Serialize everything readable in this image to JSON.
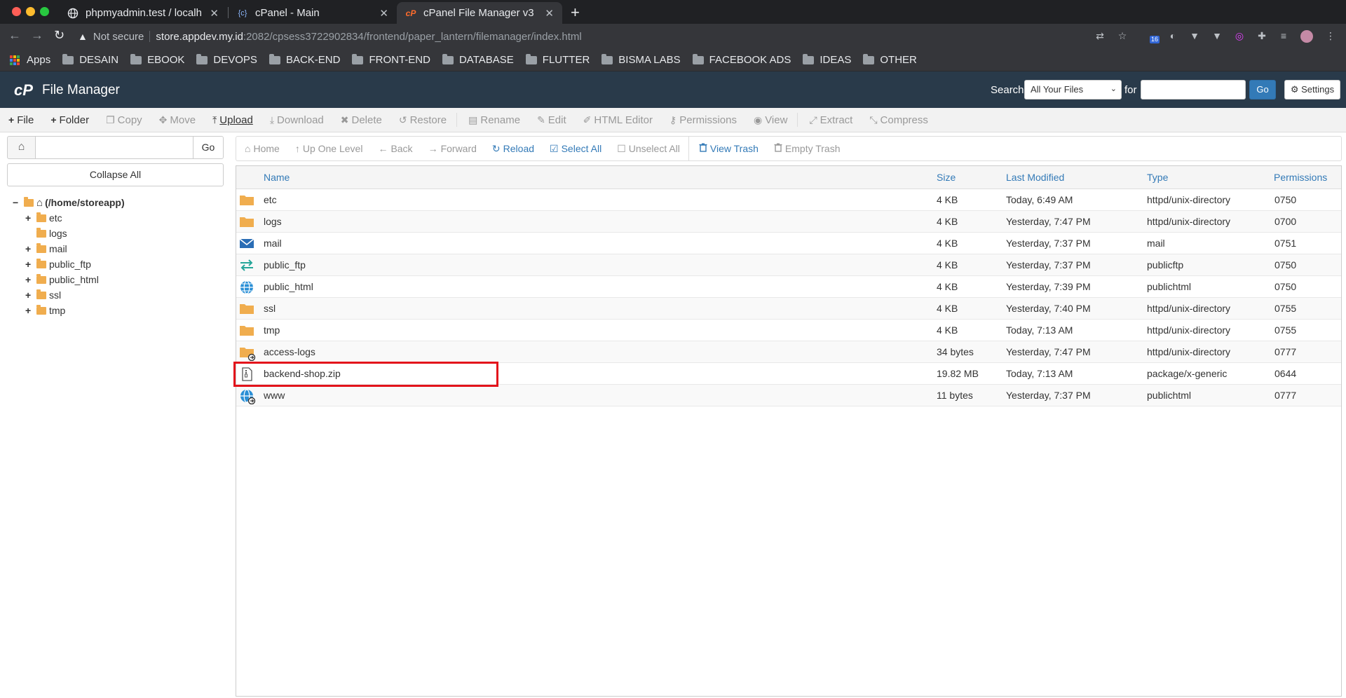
{
  "browser": {
    "tabs": [
      {
        "title": "phpmyadmin.test / localh",
        "active": false
      },
      {
        "title": "cPanel - Main",
        "active": false
      },
      {
        "title": "cPanel File Manager v3",
        "active": true
      }
    ],
    "address": {
      "warning": "Not secure",
      "host": "store.appdev.my.id",
      "path": ":2082/cpsess3722902834/frontend/paper_lantern/filemanager/index.html"
    },
    "extension_badge": "16",
    "bookmarks": [
      "Apps",
      "DESAIN",
      "EBOOK",
      "DEVOPS",
      "BACK-END",
      "FRONT-END",
      "DATABASE",
      "FLUTTER",
      "BISMA LABS",
      "FACEBOOK ADS",
      "IDEAS",
      "OTHER"
    ]
  },
  "header": {
    "logo": "cP",
    "title": "File Manager",
    "search_label": "Search",
    "search_scope": "All Your Files",
    "for_label": "for",
    "go_label": "Go",
    "settings_label": "Settings"
  },
  "actions": [
    {
      "label": "File",
      "icon": "+",
      "enabled": true
    },
    {
      "label": "Folder",
      "icon": "+",
      "enabled": true
    },
    {
      "label": "Copy",
      "icon": "❐",
      "enabled": false
    },
    {
      "label": "Move",
      "icon": "✥",
      "enabled": false
    },
    {
      "label": "Upload",
      "icon": "⤒",
      "enabled": true
    },
    {
      "label": "Download",
      "icon": "⤓",
      "enabled": false
    },
    {
      "label": "Delete",
      "icon": "✖",
      "enabled": false
    },
    {
      "label": "Restore",
      "icon": "↺",
      "enabled": false
    },
    {
      "label": "Rename",
      "icon": "▤",
      "enabled": false
    },
    {
      "label": "Edit",
      "icon": "✎",
      "enabled": false
    },
    {
      "label": "HTML Editor",
      "icon": "✐",
      "enabled": false
    },
    {
      "label": "Permissions",
      "icon": "⚷",
      "enabled": false
    },
    {
      "label": "View",
      "icon": "◉",
      "enabled": false
    },
    {
      "label": "Extract",
      "icon": "⤢",
      "enabled": false
    },
    {
      "label": "Compress",
      "icon": "⤡",
      "enabled": false
    }
  ],
  "left_panel": {
    "go_label": "Go",
    "collapse_label": "Collapse All",
    "root_label": "(/home/storeapp)",
    "tree": [
      {
        "name": "etc",
        "expandable": true
      },
      {
        "name": "logs",
        "expandable": false
      },
      {
        "name": "mail",
        "expandable": true
      },
      {
        "name": "public_ftp",
        "expandable": true
      },
      {
        "name": "public_html",
        "expandable": true
      },
      {
        "name": "ssl",
        "expandable": true
      },
      {
        "name": "tmp",
        "expandable": true
      }
    ]
  },
  "nav": [
    {
      "label": "Home",
      "icon": "⌂",
      "link": false
    },
    {
      "label": "Up One Level",
      "icon": "↑",
      "link": false
    },
    {
      "label": "Back",
      "icon": "←",
      "link": false
    },
    {
      "label": "Forward",
      "icon": "→",
      "link": false
    },
    {
      "label": "Reload",
      "icon": "↻",
      "link": true
    },
    {
      "label": "Select All",
      "icon": "☑",
      "link": true
    },
    {
      "label": "Unselect All",
      "icon": "☐",
      "link": false
    },
    {
      "label": "View Trash",
      "icon": "🗑",
      "link": true
    },
    {
      "label": "Empty Trash",
      "icon": "🗑",
      "link": false
    }
  ],
  "table": {
    "columns": [
      "Name",
      "Size",
      "Last Modified",
      "Type",
      "Permissions"
    ],
    "rows": [
      {
        "icon": "folder-icon",
        "name": "etc",
        "size": "4 KB",
        "modified": "Today, 6:49 AM",
        "type": "httpd/unix-directory",
        "perms": "0750"
      },
      {
        "icon": "folder-icon",
        "name": "logs",
        "size": "4 KB",
        "modified": "Yesterday, 7:47 PM",
        "type": "httpd/unix-directory",
        "perms": "0700"
      },
      {
        "icon": "mail-icon",
        "name": "mail",
        "size": "4 KB",
        "modified": "Yesterday, 7:37 PM",
        "type": "mail",
        "perms": "0751"
      },
      {
        "icon": "ftp-icon",
        "name": "public_ftp",
        "size": "4 KB",
        "modified": "Yesterday, 7:37 PM",
        "type": "publicftp",
        "perms": "0750"
      },
      {
        "icon": "globe-icon",
        "name": "public_html",
        "size": "4 KB",
        "modified": "Yesterday, 7:39 PM",
        "type": "publichtml",
        "perms": "0750"
      },
      {
        "icon": "folder-icon",
        "name": "ssl",
        "size": "4 KB",
        "modified": "Yesterday, 7:40 PM",
        "type": "httpd/unix-directory",
        "perms": "0755"
      },
      {
        "icon": "folder-icon",
        "name": "tmp",
        "size": "4 KB",
        "modified": "Today, 7:13 AM",
        "type": "httpd/unix-directory",
        "perms": "0755"
      },
      {
        "icon": "folder-link-icon",
        "name": "access-logs",
        "size": "34 bytes",
        "modified": "Yesterday, 7:47 PM",
        "type": "httpd/unix-directory",
        "perms": "0777"
      },
      {
        "icon": "zip-file-icon",
        "name": "backend-shop.zip",
        "size": "19.82 MB",
        "modified": "Today, 7:13 AM",
        "type": "package/x-generic",
        "perms": "0644"
      },
      {
        "icon": "globe-link-icon",
        "name": "www",
        "size": "11 bytes",
        "modified": "Yesterday, 7:37 PM",
        "type": "publichtml",
        "perms": "0777"
      }
    ]
  },
  "colors": {
    "header_bg": "#293a4a",
    "link": "#337ab7",
    "folder": "#f0ad4e",
    "highlight": "#e3131b"
  }
}
